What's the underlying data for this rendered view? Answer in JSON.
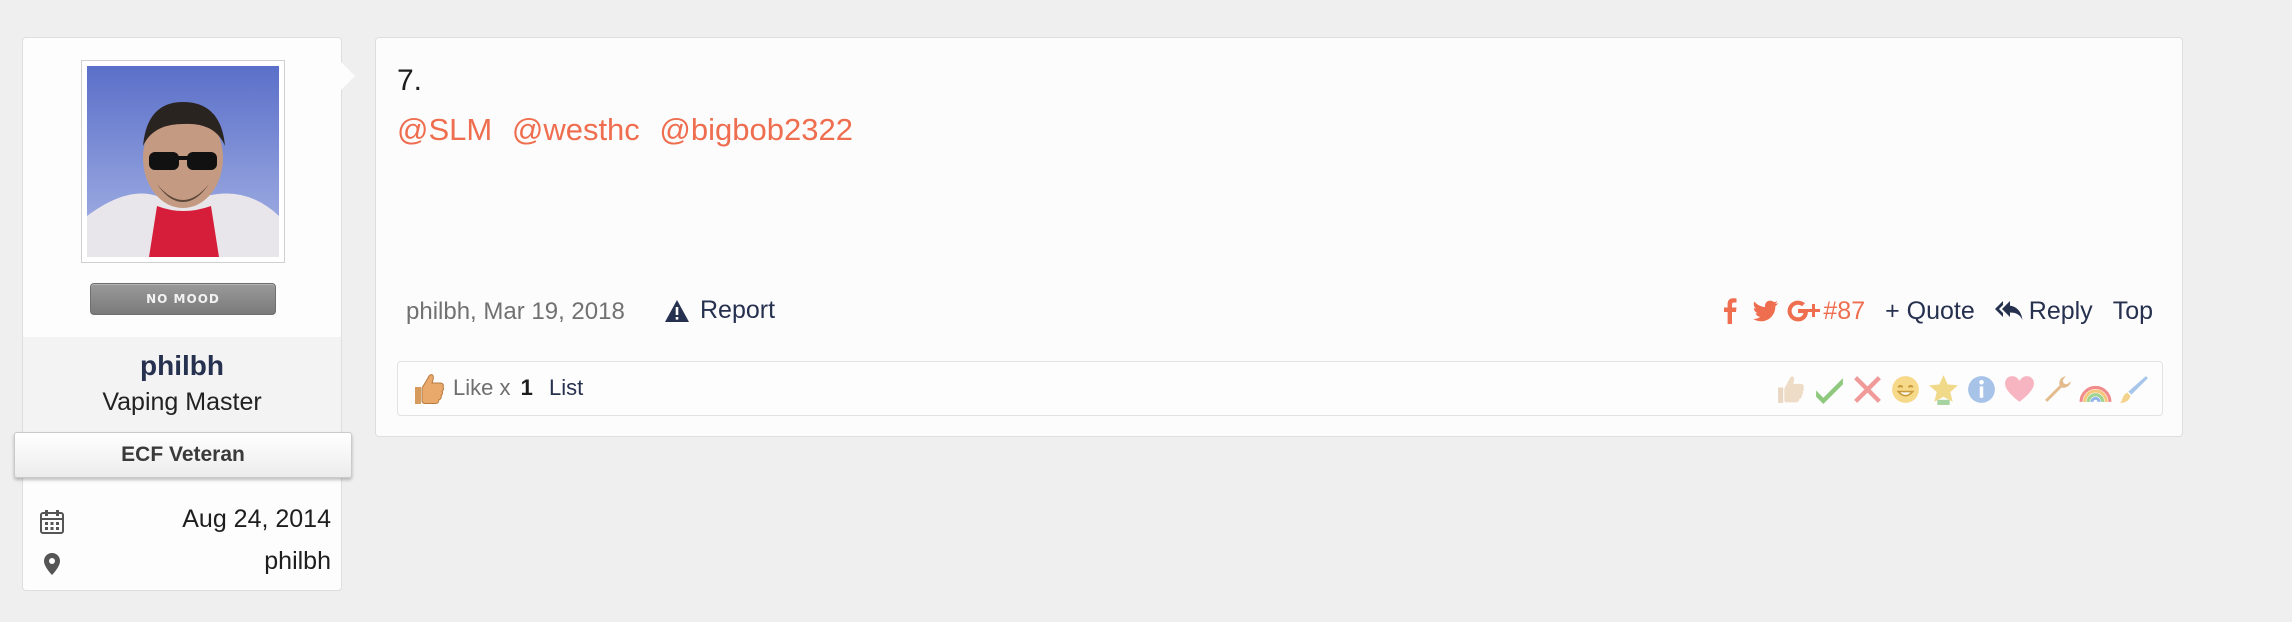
{
  "user": {
    "mood_label": "NO MOOD",
    "username": "philbh",
    "title": "Vaping Master",
    "banner": "ECF Veteran",
    "joined": "Aug 24, 2014",
    "location": "philbh"
  },
  "post": {
    "number": "7.",
    "mentions": [
      "@SLM",
      "@westhc",
      "@bigbob2322"
    ],
    "meta": "philbh, Mar 19, 2018",
    "report_label": "Report",
    "post_link": "#87",
    "quote_label": "+ Quote",
    "reply_label": "Reply",
    "top_label": "Top"
  },
  "likes": {
    "prefix": "Like x",
    "count": "1",
    "list_label": "List",
    "rating_icons": [
      "like-rating-icon",
      "agree-icon",
      "disagree-icon",
      "funny-icon",
      "winner-icon",
      "informative-icon",
      "love-icon",
      "useful-icon",
      "rainbow-icon",
      "creative-icon"
    ]
  },
  "colors": {
    "accent": "#ee6e4f",
    "link": "#26304f",
    "background": "#efefef",
    "mood_badge": "#888888"
  }
}
